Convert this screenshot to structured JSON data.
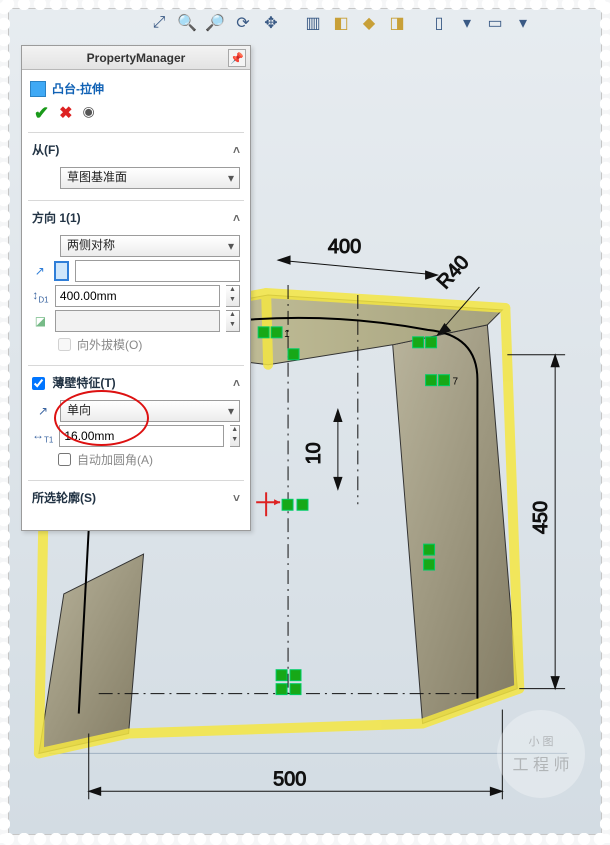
{
  "toolbar": {
    "icons": [
      "zoom-fit",
      "zoom-area",
      "zoom-select",
      "rotate",
      "pan",
      "section",
      "display-style",
      "hide-show",
      "scene",
      "view-orient",
      "dropdown",
      "screen"
    ]
  },
  "pm": {
    "title": "PropertyManager",
    "feature_name": "凸台-拉伸",
    "actions": {
      "ok": "✔",
      "cancel": "✖",
      "preview": "👁"
    },
    "sect_from": {
      "label": "从(F)",
      "plane": "草图基准面"
    },
    "sect_dir": {
      "label": "方向 1(1)",
      "end_condition": "两侧对称",
      "depth": "400.00mm",
      "draft_label": "向外拔模(O)",
      "draft_checked": false
    },
    "sect_thin": {
      "label": "薄壁特征(T)",
      "checked": true,
      "type": "单向",
      "thickness": "16.00mm",
      "auto_fillet_label": "自动加圆角(A)",
      "auto_fillet_checked": false
    },
    "sect_contour": {
      "label": "所选轮廓(S)"
    }
  },
  "dims": {
    "top": "400",
    "radius": "R40",
    "height": "450",
    "mid": "10",
    "bottom": "500"
  },
  "watermark": {
    "small": "小 图",
    "big": "工 程 师"
  }
}
